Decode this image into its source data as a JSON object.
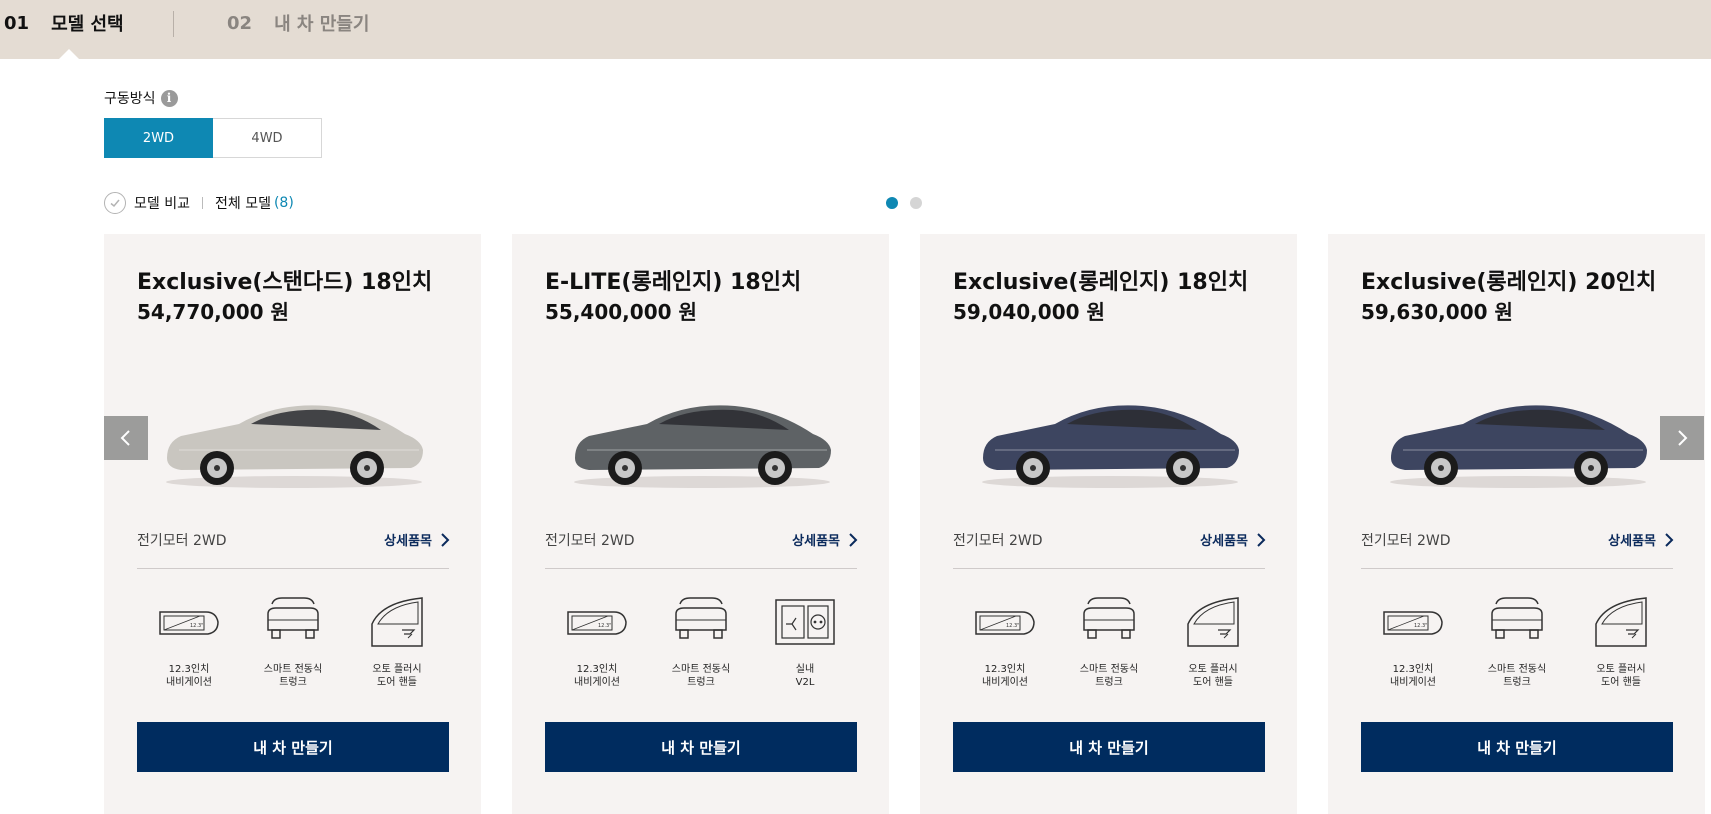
{
  "steps": [
    {
      "num": "01",
      "label": "모델 선택"
    },
    {
      "num": "02",
      "label": "내 차 만들기"
    }
  ],
  "drive": {
    "label": "구동방식",
    "info_icon": "info-icon",
    "options": [
      "2WD",
      "4WD"
    ],
    "selected": "2WD"
  },
  "compare": {
    "compare_label": "모델 비교",
    "all_models_label": "전체 모델",
    "count": "(8)"
  },
  "pagination": {
    "total": 2,
    "current": 1
  },
  "cards": [
    {
      "title": "Exclusive(스탠다드) 18인치",
      "price": "54,770,000 원",
      "car_color": "#c9c6c0",
      "engine": "전기모터 2WD",
      "detail": "상세품목",
      "features": [
        "12.3인치\n내비게이션",
        "스마트 전동식\n트렁크",
        "오토 플러시\n도어 핸들"
      ],
      "feature_icons": [
        "navigation-screen-icon",
        "power-trunk-icon",
        "flush-door-handle-icon"
      ],
      "button": "내 차 만들기"
    },
    {
      "title": "E-LITE(롱레인지) 18인치",
      "price": "55,400,000 원",
      "car_color": "#5e6265",
      "engine": "전기모터 2WD",
      "detail": "상세품목",
      "features": [
        "12.3인치\n내비게이션",
        "스마트 전동식\n트렁크",
        "실내\nV2L"
      ],
      "feature_icons": [
        "navigation-screen-icon",
        "power-trunk-icon",
        "v2l-outlet-icon"
      ],
      "button": "내 차 만들기"
    },
    {
      "title": "Exclusive(롱레인지) 18인치",
      "price": "59,040,000 원",
      "car_color": "#3d4560",
      "engine": "전기모터 2WD",
      "detail": "상세품목",
      "features": [
        "12.3인치\n내비게이션",
        "스마트 전동식\n트렁크",
        "오토 플러시\n도어 핸들"
      ],
      "feature_icons": [
        "navigation-screen-icon",
        "power-trunk-icon",
        "flush-door-handle-icon"
      ],
      "button": "내 차 만들기"
    },
    {
      "title": "Exclusive(롱레인지) 20인치",
      "price": "59,630,000 원",
      "car_color": "#3d4560",
      "engine": "전기모터 2WD",
      "detail": "상세품목",
      "features": [
        "12.3인치\n내비게이션",
        "스마트 전동식\n트렁크",
        "오토 플러시\n도어 핸들"
      ],
      "feature_icons": [
        "navigation-screen-icon",
        "power-trunk-icon",
        "flush-door-handle-icon"
      ],
      "button": "내 차 만들기"
    }
  ],
  "colors": {
    "accent": "#0e88b3",
    "button": "#002c5f",
    "step_bar": "#e4dcd3",
    "card_bg": "#f6f3f2"
  }
}
